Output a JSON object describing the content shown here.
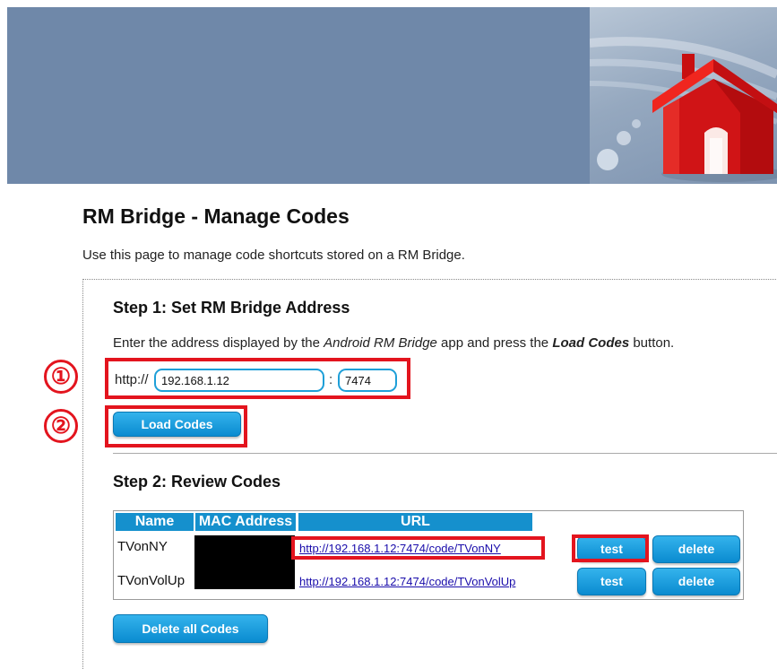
{
  "header": {
    "icon": "house-icon"
  },
  "page": {
    "title": "RM Bridge - Manage Codes",
    "description": "Use this page to manage code shortcuts stored on a RM Bridge."
  },
  "step1": {
    "heading": "Step 1: Set RM Bridge Address",
    "desc_prefix": "Enter the address displayed by the ",
    "desc_app": "Android RM Bridge",
    "desc_middle": " app and press the ",
    "desc_button": "Load Codes",
    "desc_suffix": " button.",
    "protocol_label": "http://",
    "host_value": "192.168.1.12",
    "port_separator": ":",
    "port_value": "7474",
    "load_button": "Load Codes"
  },
  "annotations": {
    "marker1": "①",
    "marker2": "②",
    "color": "#e3141e"
  },
  "step2": {
    "heading": "Step 2: Review Codes",
    "columns": {
      "name": "Name",
      "mac": "MAC Address",
      "url": "URL"
    },
    "rows": [
      {
        "name": "TVonNY",
        "url": "http://192.168.1.12:7474/code/TVonNY",
        "test": "test",
        "delete": "delete"
      },
      {
        "name": "TVonVolUp",
        "url": "http://192.168.1.12:7474/code/TVonVolUp",
        "test": "test",
        "delete": "delete"
      }
    ],
    "delete_all_button": "Delete all Codes"
  },
  "colors": {
    "accent": "#1590cd",
    "banner": "#6f88a9"
  }
}
